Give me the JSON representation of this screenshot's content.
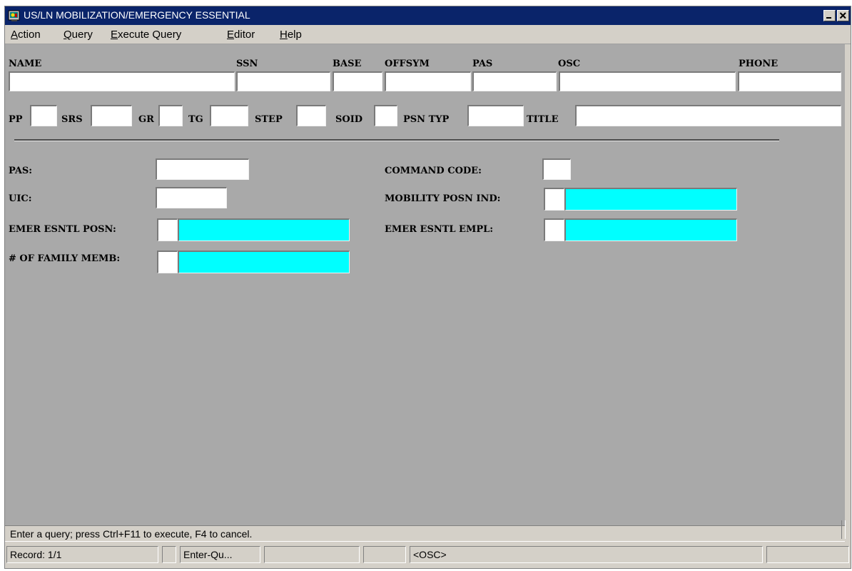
{
  "window": {
    "title": "US/LN MOBILIZATION/EMERGENCY ESSENTIAL",
    "minimize_glyph": "_",
    "close_glyph": "×"
  },
  "menu": {
    "action": "Action",
    "query": "Query",
    "execute_query": "Execute Query",
    "editor": "Editor",
    "help": "Help"
  },
  "header": {
    "name": "NAME",
    "ssn": "SSN",
    "base": "BASE",
    "offsym": "OFFSYM",
    "pas": "PAS",
    "osc": "OSC",
    "phone": "PHONE",
    "pp": "PP",
    "srs": "SRS",
    "gr": "GR",
    "tg": "TG",
    "step": "STEP",
    "soid": "SOID",
    "psn_typ": "PSN TYP",
    "title": "TITLE"
  },
  "detail": {
    "pas": "PAS:",
    "uic": "UIC:",
    "emer_esntl_posn": "EMER ESNTL POSN:",
    "family_memb": "# OF FAMILY MEMB:",
    "command_code": "COMMAND CODE:",
    "mobility_posn_ind": "MOBILITY POSN IND:",
    "emer_esntl_empl": "EMER ESNTL EMPL:"
  },
  "hint": "Enter a query;  press Ctrl+F11 to execute, F4 to cancel.",
  "status": {
    "record": "Record: 1/1",
    "mode": "Enter-Qu...",
    "field": "<OSC>"
  },
  "colors": {
    "titlebar": "#0a246a",
    "form_bg": "#a9a9a9",
    "lov_field": "#00ffff"
  }
}
